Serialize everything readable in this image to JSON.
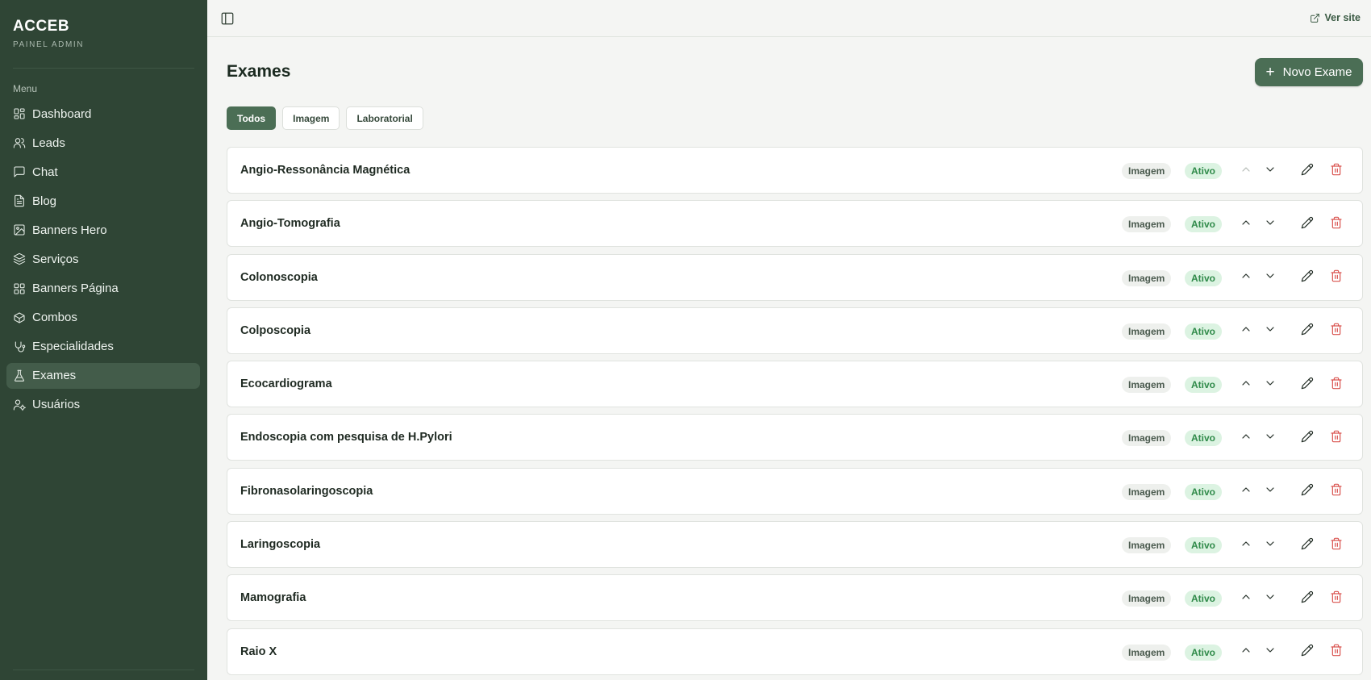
{
  "sidebar": {
    "brand": "ACCEB",
    "subtitle": "PAINEL ADMIN",
    "menu_label": "Menu",
    "items": [
      {
        "label": "Dashboard",
        "icon": "dashboard-grid-icon"
      },
      {
        "label": "Leads",
        "icon": "users-icon"
      },
      {
        "label": "Chat",
        "icon": "chat-bubble-icon"
      },
      {
        "label": "Blog",
        "icon": "document-icon"
      },
      {
        "label": "Banners Hero",
        "icon": "image-icon"
      },
      {
        "label": "Serviços",
        "icon": "layers-icon"
      },
      {
        "label": "Banners Página",
        "icon": "grid-icon"
      },
      {
        "label": "Combos",
        "icon": "package-icon"
      },
      {
        "label": "Especialidades",
        "icon": "stethoscope-icon"
      },
      {
        "label": "Exames",
        "icon": "flask-icon",
        "active": true
      },
      {
        "label": "Usuários",
        "icon": "user-cog-icon"
      }
    ]
  },
  "topbar": {
    "view_site_label": "Ver site"
  },
  "main": {
    "title": "Exames",
    "new_button_label": "Novo Exame",
    "filters": [
      {
        "label": "Todos",
        "active": true
      },
      {
        "label": "Imagem",
        "active": false
      },
      {
        "label": "Laboratorial",
        "active": false
      }
    ],
    "exams": [
      {
        "name": "Angio-Ressonância Magnética",
        "type": "Imagem",
        "status": "Ativo"
      },
      {
        "name": "Angio-Tomografia",
        "type": "Imagem",
        "status": "Ativo"
      },
      {
        "name": "Colonoscopia",
        "type": "Imagem",
        "status": "Ativo"
      },
      {
        "name": "Colposcopia",
        "type": "Imagem",
        "status": "Ativo"
      },
      {
        "name": "Ecocardiograma",
        "type": "Imagem",
        "status": "Ativo"
      },
      {
        "name": "Endoscopia com pesquisa de H.Pylori",
        "type": "Imagem",
        "status": "Ativo"
      },
      {
        "name": "Fibronasolaringoscopia",
        "type": "Imagem",
        "status": "Ativo"
      },
      {
        "name": "Laringoscopia",
        "type": "Imagem",
        "status": "Ativo"
      },
      {
        "name": "Mamografia",
        "type": "Imagem",
        "status": "Ativo"
      },
      {
        "name": "Raio X",
        "type": "Imagem",
        "status": "Ativo"
      }
    ]
  },
  "colors": {
    "sidebar_bg": "#2f4535",
    "accent": "#4b6e55",
    "status_active_bg": "#dcf3e2",
    "status_active_text": "#2f8a49",
    "danger": "#d9534f"
  }
}
